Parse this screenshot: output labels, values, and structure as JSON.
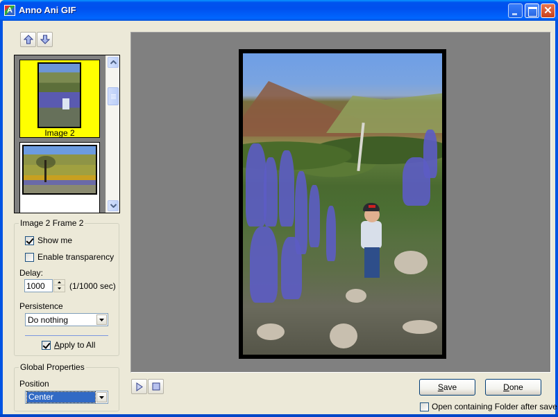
{
  "window": {
    "title": "Anno Ani GIF",
    "controls": {
      "minimize": "minimize",
      "maximize": "maximize",
      "close": "✕"
    }
  },
  "order_buttons": {
    "up": "move-up",
    "down": "move-down"
  },
  "thumbnails": [
    {
      "label": "Image 2",
      "selected": true,
      "highlight_color": "#FFFF00"
    },
    {
      "label": "",
      "selected": false
    }
  ],
  "frame_group": {
    "title": "Image 2  Frame 2",
    "show_me": {
      "label": "Show me",
      "checked": true
    },
    "transparency": {
      "label": "Enable transparency",
      "checked": false
    },
    "delay_label": "Delay:",
    "delay_value": "1000",
    "delay_unit": "(1/1000 sec)",
    "persistence_label": "Persistence",
    "persistence_value": "Do nothing",
    "apply_all": {
      "label_prefix": "",
      "label_ul": "A",
      "label_rest": "pply to All",
      "checked": true
    }
  },
  "global_group": {
    "title": "Global Properties",
    "position_label": "Position",
    "position_value": "Center"
  },
  "preview": {
    "background": "#808080",
    "image_description": "Child walking on rocky trail among purple lupine flowers below green hills"
  },
  "playback": {
    "play": "play",
    "stop": "stop"
  },
  "actions": {
    "save": {
      "ul": "S",
      "rest": "ave"
    },
    "done": {
      "ul": "D",
      "rest": "one"
    },
    "open_folder": {
      "label": "Open containing Folder after save.",
      "checked": false
    }
  }
}
